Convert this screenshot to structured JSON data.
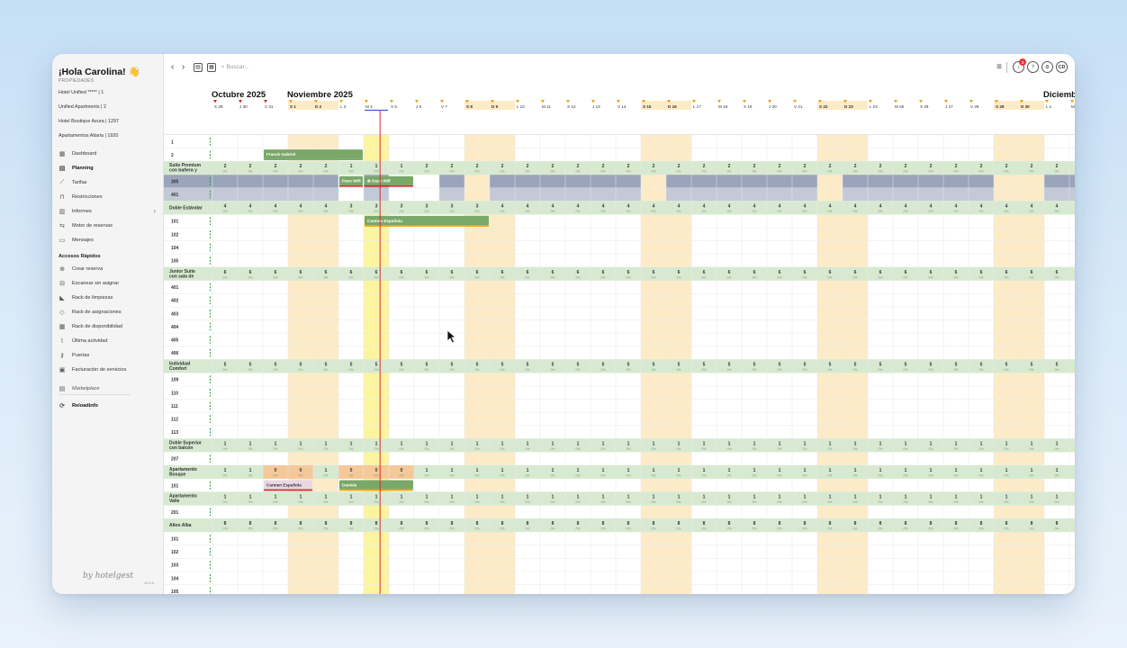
{
  "sidebar": {
    "greeting": "¡Hola Carolina! 👋",
    "properties_label": "PROPIEDADES",
    "properties": [
      "Hotel Unified ***** | 1",
      "Unified Apartments | 2",
      "Hotel Boutique Azura | 1297",
      "Apartamentos Altaria | 1920"
    ],
    "nav": [
      {
        "label": "Dashboard",
        "icon": "dashboard-icon",
        "glyph": "▦",
        "active": false
      },
      {
        "label": "Planning",
        "icon": "calendar-icon",
        "glyph": "▤",
        "active": true
      },
      {
        "label": "Tarifas",
        "icon": "chart-line-icon",
        "glyph": "⟋",
        "active": false
      },
      {
        "label": "Restricciones",
        "icon": "lock-icon",
        "glyph": "⊓",
        "active": false
      },
      {
        "label": "Informes",
        "icon": "report-icon",
        "glyph": "▥",
        "active": false
      },
      {
        "label": "Motor de reservas",
        "icon": "engine-icon",
        "glyph": "⇆",
        "active": false
      },
      {
        "label": "Mensajes",
        "icon": "message-icon",
        "glyph": "▭",
        "active": false
      }
    ],
    "accesos_title": "Accesos Rápidos",
    "accesos": [
      {
        "label": "Crear reserva",
        "icon": "plus-circle-icon",
        "glyph": "⊕"
      },
      {
        "label": "Escanear sin asignar",
        "icon": "scan-icon",
        "glyph": "⊟"
      },
      {
        "label": "Rack de limpiezas",
        "icon": "broom-icon",
        "glyph": "◣"
      },
      {
        "label": "Rack de asignaciones",
        "icon": "assign-icon",
        "glyph": "◇"
      },
      {
        "label": "Rack de disponibilidad",
        "icon": "grid-icon",
        "glyph": "▦"
      },
      {
        "label": "Última actividad",
        "icon": "activity-icon",
        "glyph": "⌇"
      },
      {
        "label": "Puertas",
        "icon": "key-icon",
        "glyph": "⚷"
      },
      {
        "label": "Facturación de servicios",
        "icon": "invoice-icon",
        "glyph": "▣"
      }
    ],
    "marketplace": "Marketplace",
    "reloadinfo": "Reloadinfo",
    "brand": "by hotelgest",
    "version": "v3.6.8"
  },
  "toolbar": {
    "search_placeholder": "Buscar..."
  },
  "header": {
    "user_initials": "CD",
    "notif_count": "3",
    "months": [
      {
        "label": "Octubre 2025",
        "col": 0
      },
      {
        "label": "Noviembre 2025",
        "col": 3
      },
      {
        "label": "Diciembre",
        "col": 33
      }
    ],
    "days": [
      "X 29",
      "J 30",
      "V 31",
      "S 1",
      "D 2",
      "L 3",
      "M 4",
      "X 5",
      "J 6",
      "V 7",
      "S 8",
      "D 9",
      "L 10",
      "M 11",
      "X 12",
      "J 13",
      "V 14",
      "S 15",
      "D 16",
      "L 17",
      "M 18",
      "X 19",
      "J 20",
      "V 21",
      "S 22",
      "D 23",
      "L 24",
      "M 25",
      "X 26",
      "J 27",
      "V 28",
      "S 29",
      "D 30",
      "L 1",
      "M 2"
    ],
    "weekend_cols": [
      3,
      4,
      10,
      11,
      17,
      18,
      24,
      25,
      31,
      32
    ],
    "flag_cols": [
      0,
      1,
      2,
      3,
      4,
      5,
      6,
      7,
      8,
      9,
      10,
      11,
      12,
      13,
      14,
      15,
      16,
      17,
      18,
      19,
      20,
      21,
      22,
      23,
      24,
      25,
      26,
      27,
      28,
      29,
      30,
      31,
      32,
      33,
      34
    ],
    "today_col": 6
  },
  "rooms": [
    {
      "t": "r",
      "label": "1"
    },
    {
      "t": "r",
      "label": "2"
    },
    {
      "t": "g",
      "label": "Suite Premium con bañera y ...",
      "v": "2",
      "e": [
        [
          5,
          "1"
        ],
        [
          6,
          "1"
        ],
        [
          7,
          "1"
        ]
      ]
    },
    {
      "t": "r",
      "label": "305",
      "blocked": true
    },
    {
      "t": "r",
      "label": "401",
      "blocked": true,
      "light": true
    },
    {
      "t": "g",
      "label": "Doble Estándar",
      "v": "4",
      "e": [
        [
          5,
          "3"
        ],
        [
          6,
          "3"
        ],
        [
          7,
          "3"
        ],
        [
          8,
          "3"
        ],
        [
          9,
          "3"
        ],
        [
          10,
          "3"
        ]
      ]
    },
    {
      "t": "r",
      "label": "101"
    },
    {
      "t": "r",
      "label": "102"
    },
    {
      "t": "r",
      "label": "104"
    },
    {
      "t": "r",
      "label": "105"
    },
    {
      "t": "g",
      "label": "Junior Suite con sala de estar",
      "v": "6",
      "e": []
    },
    {
      "t": "r",
      "label": "401"
    },
    {
      "t": "r",
      "label": "402"
    },
    {
      "t": "r",
      "label": "403"
    },
    {
      "t": "r",
      "label": "404"
    },
    {
      "t": "r",
      "label": "405"
    },
    {
      "t": "r",
      "label": "406"
    },
    {
      "t": "g",
      "label": "Individual Comfort",
      "v": "5",
      "e": []
    },
    {
      "t": "r",
      "label": "109"
    },
    {
      "t": "r",
      "label": "110"
    },
    {
      "t": "r",
      "label": "111"
    },
    {
      "t": "r",
      "label": "112"
    },
    {
      "t": "r",
      "label": "113"
    },
    {
      "t": "g",
      "label": "Doble Superior con balcón",
      "v": "1",
      "e": []
    },
    {
      "t": "r",
      "label": "207"
    },
    {
      "t": "g",
      "label": "Apartamento Bosque",
      "v": "1",
      "e": [
        [
          2,
          "0"
        ],
        [
          3,
          "0"
        ],
        [
          5,
          "0"
        ],
        [
          6,
          "0"
        ],
        [
          7,
          "0"
        ]
      ],
      "orange": [
        2,
        3,
        5,
        6,
        7
      ]
    },
    {
      "t": "r",
      "label": "101"
    },
    {
      "t": "g",
      "label": "Apartamento Valle",
      "v": "1",
      "e": []
    },
    {
      "t": "r",
      "label": "201"
    },
    {
      "t": "g",
      "label": "Altos Alba",
      "v": "8",
      "e": []
    },
    {
      "t": "r",
      "label": "101"
    },
    {
      "t": "r",
      "label": "102"
    },
    {
      "t": "r",
      "label": "103"
    },
    {
      "t": "r",
      "label": "104"
    },
    {
      "t": "r",
      "label": "105"
    },
    {
      "t": "r",
      "label": "201"
    }
  ],
  "blocked_gaps": [
    [
      5,
      6
    ],
    [
      7,
      9
    ],
    [
      10,
      11
    ],
    [
      17,
      18
    ],
    [
      24,
      25
    ],
    [
      31,
      33
    ]
  ],
  "bookings": [
    {
      "row": 1,
      "start": 2,
      "end": 6,
      "label": "Franck Gabriel",
      "fill": "#7aa869",
      "line": "#7aa869"
    },
    {
      "row": 3,
      "start": 5,
      "end": 6,
      "label": "Paco Wifi",
      "fill": "#7aa869",
      "line": "#d32f2f"
    },
    {
      "row": 3,
      "start": 6,
      "end": 8,
      "label": "⊕ Paco Wifi",
      "fill": "#7aa869",
      "line": "#d32f2f"
    },
    {
      "row": 6,
      "start": 6,
      "end": 11,
      "label": "Carmen Española",
      "fill": "#7aa869",
      "line": "#f0a400"
    },
    {
      "row": 26,
      "start": 2,
      "end": 4,
      "label": "Carmen Española",
      "fill": "#e8d8e3",
      "line": "#d32f2f",
      "dark": true
    },
    {
      "row": 26,
      "start": 5,
      "end": 8,
      "label": "Daniela",
      "fill": "#7aa869",
      "line": "#f0a400"
    }
  ],
  "colors": {
    "weekend": "#fdebc8",
    "group": "#d7ead1",
    "orange": "#f5c89a",
    "blocked": "#9aa5bb",
    "blocked_light": "#c3c9d7",
    "today": "#fdf4a0",
    "today_line": "#d32f2f"
  }
}
